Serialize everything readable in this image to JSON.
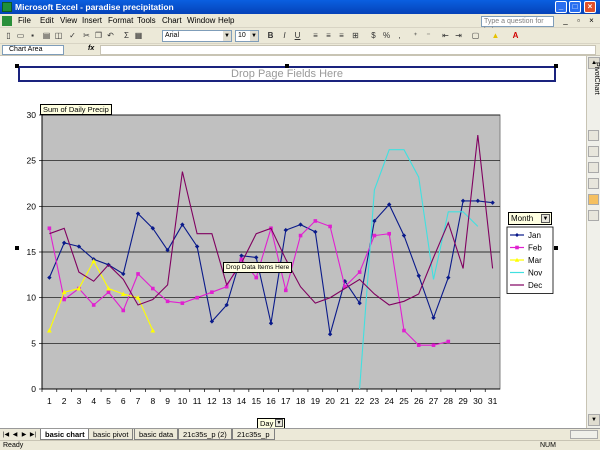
{
  "window": {
    "title": "Microsoft Excel - paradise precipitation"
  },
  "menu": {
    "items": [
      "File",
      "Edit",
      "View",
      "Insert",
      "Format",
      "Tools",
      "Chart",
      "Window",
      "Help"
    ],
    "help_placeholder": "Type a question for help"
  },
  "toolbar": {
    "font_name": "Arial",
    "font_size": "10",
    "bold": "B",
    "italic": "I",
    "underline": "U",
    "currency": "$",
    "percent": "%",
    "comma": ","
  },
  "formula": {
    "name_box": "Chart Area",
    "fx": "fx"
  },
  "pivot": {
    "page_fields_placeholder": "Drop Page Fields Here",
    "data_field": "Sum of Daily Precip",
    "data_items_placeholder": "Drop Data Items Here",
    "row_field": "Day",
    "legend_field": "Month"
  },
  "sheet_tabs": [
    "basic chart",
    "basic pivot",
    "basic data",
    "21c35s_p (2)",
    "21c35s_p"
  ],
  "status": {
    "ready": "Ready",
    "num": "NUM"
  },
  "side_panel": {
    "label": "PivotChart"
  },
  "chart_data": {
    "type": "line",
    "title": "",
    "xlabel": "Day",
    "ylabel": "",
    "ylim": [
      0,
      30
    ],
    "yticks": [
      0,
      5,
      10,
      15,
      20,
      25,
      30
    ],
    "categories": [
      1,
      2,
      3,
      4,
      5,
      6,
      7,
      8,
      9,
      10,
      11,
      12,
      13,
      14,
      15,
      16,
      17,
      18,
      19,
      20,
      21,
      22,
      23,
      24,
      25,
      26,
      27,
      28,
      29,
      30,
      31
    ],
    "grid": true,
    "legend_placement": "right",
    "series": [
      {
        "name": "Jan",
        "color": "#0a1a8a",
        "marker": "diamond",
        "values": [
          12.2,
          16,
          15.6,
          14.2,
          13.6,
          12.6,
          19.2,
          17.6,
          15.2,
          18,
          15.6,
          7.4,
          9.2,
          14.6,
          14.4,
          7.2,
          17.4,
          18,
          17.2,
          6,
          11.8,
          9.4,
          18.4,
          20.2,
          16.8,
          12.4,
          7.8,
          12.2,
          20.6,
          20.6,
          20.4
        ]
      },
      {
        "name": "Feb",
        "color": "#e020d0",
        "marker": "square",
        "values": [
          17.6,
          9.8,
          11,
          9.2,
          10.6,
          8.6,
          12.6,
          11,
          9.6,
          9.4,
          10,
          10.6,
          11.2,
          14.2,
          12.2,
          17.6,
          10.8,
          16.8,
          18.4,
          17.8,
          11.2,
          12.8,
          16.8,
          17,
          6.4,
          4.8,
          4.8,
          5.2,
          null,
          null,
          null
        ]
      },
      {
        "name": "Mar",
        "color": "#ffff00",
        "marker": "triangle",
        "values": [
          6.4,
          10.6,
          11,
          14,
          11,
          10.4,
          10,
          6.4,
          null,
          null,
          null,
          null,
          null,
          null,
          null,
          null,
          null,
          null,
          null,
          null,
          null,
          null,
          null,
          null,
          null,
          null,
          null,
          null,
          null,
          null,
          null
        ]
      },
      {
        "name": "Nov",
        "color": "#40e0e0",
        "marker": "none",
        "values": [
          null,
          null,
          null,
          null,
          null,
          null,
          null,
          null,
          null,
          null,
          null,
          null,
          null,
          null,
          null,
          null,
          null,
          null,
          null,
          null,
          null,
          0,
          21.8,
          26.2,
          26.2,
          23.2,
          12,
          19.4,
          19.4,
          17.8,
          null
        ]
      },
      {
        "name": "Dec",
        "color": "#800060",
        "marker": "none",
        "values": [
          17,
          17.6,
          12.8,
          11.8,
          13.6,
          12,
          9.2,
          9.8,
          11.4,
          23.8,
          17,
          17,
          11.4,
          13.8,
          17,
          17.6,
          14.2,
          11.2,
          9.4,
          10,
          11,
          12,
          10.4,
          9.2,
          9.6,
          10.4,
          14.4,
          18.2,
          13.2,
          27.8,
          13.2
        ]
      }
    ]
  }
}
